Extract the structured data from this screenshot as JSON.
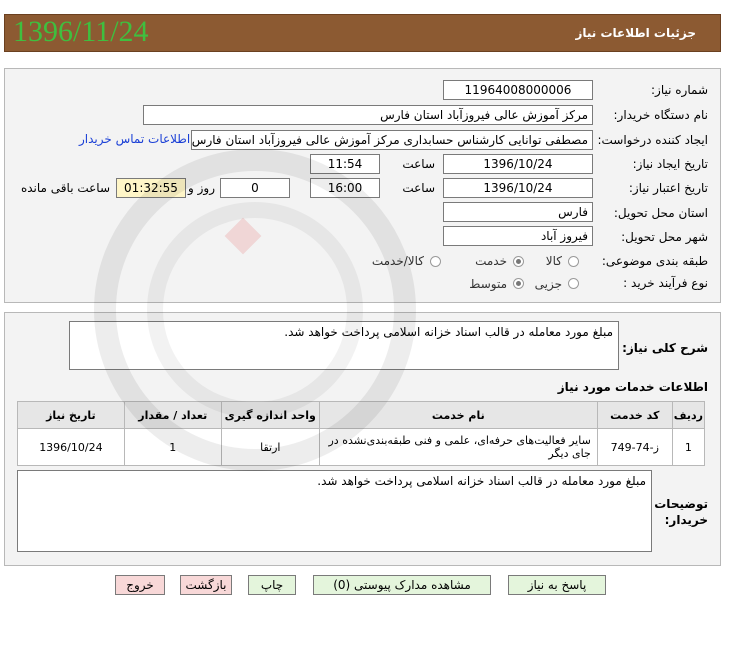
{
  "header": {
    "title": "جزئیات اطلاعات نیاز",
    "date": "1396/11/24"
  },
  "info": {
    "need_number_label": "شماره نیاز:",
    "need_number": "11964008000006",
    "buyer_org_label": "نام دستگاه خریدار:",
    "buyer_org": "مرکز آموزش عالی فیروزآباد استان فارس",
    "requester_label": "ایجاد کننده درخواست:",
    "requester": "مصطفی توانایی کارشناس حسابداری مرکز آموزش عالی فیروزآباد استان فارس",
    "contact_link": "اطلاعات تماس خریدار",
    "created_label": "تاریخ ایجاد نیاز:",
    "created_date": "1396/10/24",
    "time_label": "ساعت",
    "created_time": "11:54",
    "validity_label": "تاریخ اعتبار نیاز:",
    "validity_date": "1396/10/24",
    "validity_time": "16:00",
    "days": "0",
    "days_label": "روز و",
    "remaining_time": "01:32:55",
    "remaining_label": "ساعت باقی مانده",
    "province_label": "استان محل تحویل:",
    "province": "فارس",
    "city_label": "شهر محل تحویل:",
    "city": "فیروز آباد",
    "category_label": "طبقه بندی موضوعی:",
    "category_options": [
      "کالا",
      "خدمت",
      "کالا/خدمت"
    ],
    "category_selected": "خدمت",
    "purchase_type_label": "نوع فرآیند خرید :",
    "purchase_options": [
      "جزیی",
      "متوسط"
    ],
    "purchase_selected": "متوسط"
  },
  "summary": {
    "label": "شرح کلی نیاز:",
    "text": "مبلغ مورد معامله در قالب اسناد خزانه اسلامی پرداخت خواهد شد."
  },
  "services": {
    "title": "اطلاعات خدمات مورد نیاز",
    "headers": [
      "ردیف",
      "کد خدمت",
      "نام خدمت",
      "واحد اندازه گیری",
      "تعداد / مقدار",
      "تاریخ نیاز"
    ],
    "rows": [
      {
        "row": "1",
        "code": "ز-74-749",
        "name": "سایر فعالیت‌های حرفه‌ای، علمی و فنی طبقه‌بندی‌نشده در جای دیگر",
        "unit": "ارتقا",
        "qty": "1",
        "date": "1396/10/24"
      }
    ]
  },
  "buyer_notes": {
    "label_line1": "توضیحات",
    "label_line2": "خریدار:",
    "text": "مبلغ مورد معامله در قالب اسناد خزانه اسلامی پرداخت خواهد شد."
  },
  "buttons": {
    "reply": "پاسخ به نیاز",
    "attachments": "مشاهده مدارک پیوستی (0)",
    "print": "چاپ",
    "back": "بازگشت",
    "exit": "خروج"
  },
  "colors": {
    "header_bg": "#8c5a32",
    "date_green": "#3fbf3f",
    "timer_bg": "#fff6c8",
    "link_blue": "#1a3fd6"
  }
}
